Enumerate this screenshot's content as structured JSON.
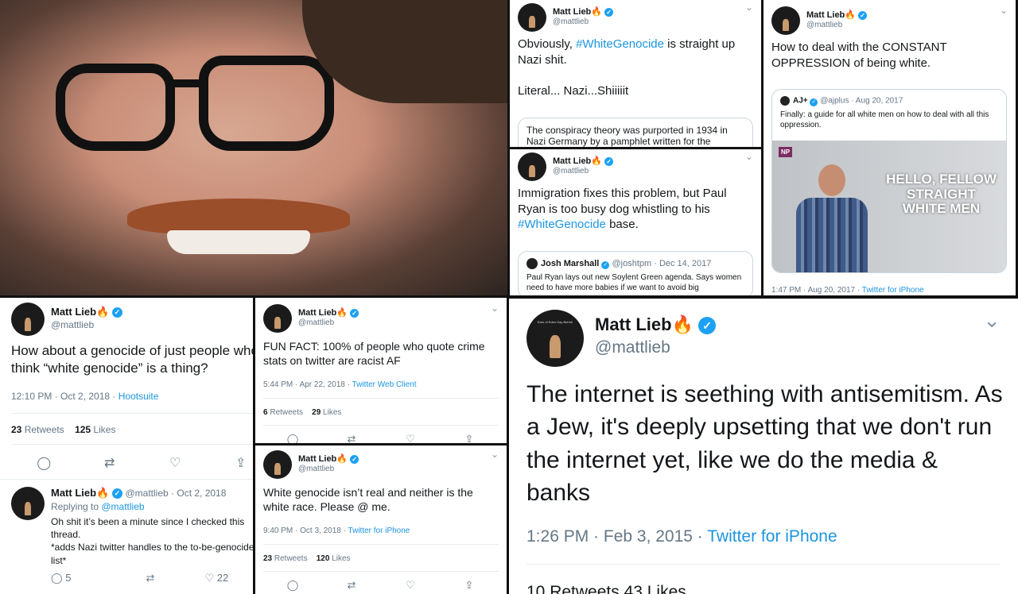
{
  "common": {
    "display_name": "Matt Lieb",
    "flame": "🔥",
    "verified": "✓",
    "chevron": "⌄",
    "avatar_text": "Ears of Eden Day Buhhh"
  },
  "photo": {
    "icon": "person-photo"
  },
  "t1": {
    "handle": "@mattlieb",
    "body_1": "Obviously, ",
    "hashtag": "#WhiteGenocide",
    "body_2": " is straight up Nazi shit.",
    "body_3": "Literal... Nazi...Shiiiiit",
    "quote": "The conspiracy theory was purported in 1934 in Nazi Germany by a pamphlet written for the"
  },
  "t2": {
    "handle": "@mattlieb",
    "body": "How to deal with the CONSTANT OPPRESSION of being white.",
    "quote_user": "AJ+",
    "quote_handle": "@ajplus · Aug 20, 2017",
    "quote_text": "Finally: a guide for all white men on how to deal with all this oppression.",
    "np_badge": "NP",
    "video_caption": "HELLO, FELLOW STRAIGHT WHITE MEN",
    "time": "1:47 PM · Aug 20, 2017 · ",
    "source": "Twitter for iPhone"
  },
  "t3": {
    "handle": "@mattlieb",
    "body_1": "Immigration fixes this problem, but Paul Ryan is too busy dog whistling to his ",
    "hashtag": "#WhiteGenocide",
    "body_2": " base.",
    "quote_user": "Josh Marshall",
    "quote_handle": "@joshtpm · Dec 14, 2017",
    "quote_text": "Paul Ryan lays out new Soylent Green agenda. Says women need to have more babies if we want to avoid big"
  },
  "t4": {
    "handle": "@mattlieb",
    "body": "How about a genocide of just people who think “white genocide” is a thing?",
    "time": "12:10 PM · Oct 2, 2018 · ",
    "source": "Hootsuite",
    "retweets_n": "23",
    "retweets_l": " Retweets",
    "likes_n": "125",
    "likes_l": " Likes",
    "reply": {
      "handle": "@mattlieb · Oct 2, 2018",
      "replying": "Replying to ",
      "replying_to": "@mattlieb",
      "text_1": "Oh shit it’s been a minute since I checked this thread.",
      "text_2": "*adds Nazi twitter handles to the to-be-genocided list*",
      "reply_count": "5",
      "like_count": "22"
    }
  },
  "t5": {
    "handle": "@mattlieb",
    "body": "FUN FACT: 100% of people who quote crime stats on twitter are racist AF",
    "time": "5:44 PM · Apr 22, 2018 · ",
    "source": "Twitter Web Client",
    "retweets_n": "6",
    "retweets_l": " Retweets",
    "likes_n": "29",
    "likes_l": " Likes"
  },
  "t6": {
    "handle": "@mattlieb",
    "body": "White genocide isn’t real and neither is the white race. Please @ me.",
    "time": "9:40 PM · Oct 3, 2018 · ",
    "source": "Twitter for iPhone",
    "retweets_n": "23",
    "retweets_l": " Retweets",
    "likes_n": "120",
    "likes_l": " Likes"
  },
  "t7": {
    "handle": "@mattlieb",
    "body": "The internet is seething with antisemitism. As a Jew, it's deeply upsetting that we don't run the internet yet, like we do the media & banks",
    "time": "1:26 PM · Feb 3, 2015 · ",
    "source": "Twitter for iPhone",
    "stats_partial": "10 Retweets   43 Likes"
  },
  "icons": {
    "reply": "◯",
    "retweet": "⇄",
    "like": "♡",
    "share": "⇪"
  }
}
